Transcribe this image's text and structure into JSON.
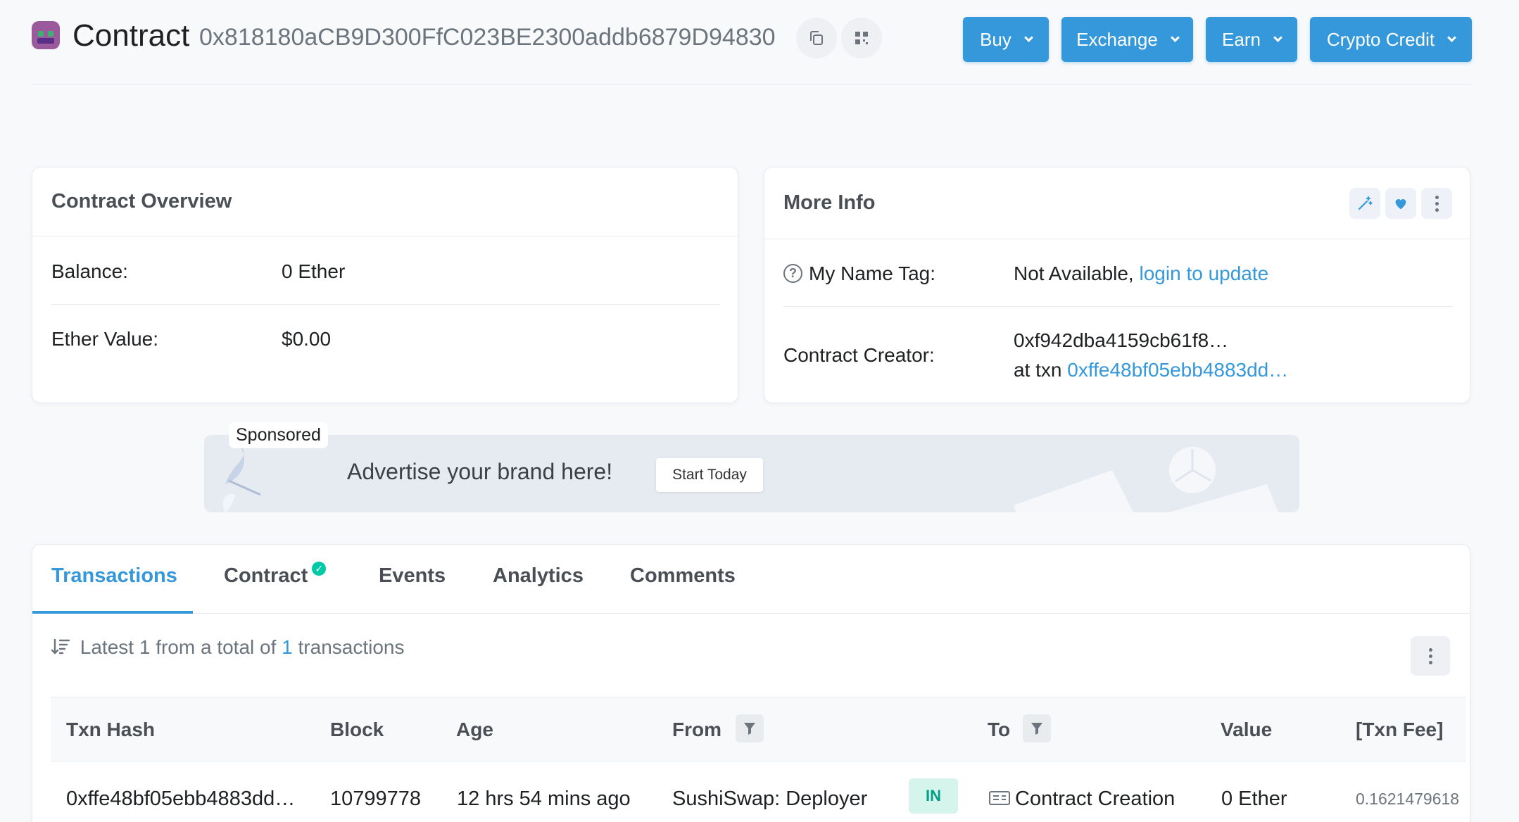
{
  "header": {
    "title": "Contract",
    "address": "0x818180aCB9D300FfC023BE2300addb6879D94830",
    "buttons": [
      "Buy",
      "Exchange",
      "Earn",
      "Crypto Credit"
    ]
  },
  "overview": {
    "title": "Contract Overview",
    "balance_label": "Balance:",
    "balance_value": "0 Ether",
    "ether_value_label": "Ether Value:",
    "ether_value": "$0.00"
  },
  "more_info": {
    "title": "More Info",
    "name_tag_label": "My Name Tag:",
    "name_tag_value": "Not Available,",
    "name_tag_link": "login to update",
    "creator_label": "Contract Creator:",
    "creator_address": "0xf942dba4159cb61f8…",
    "creator_txn_prefix": "at txn",
    "creator_txn": "0xffe48bf05ebb4883dd…"
  },
  "ad": {
    "badge": "Sponsored",
    "text": "Advertise your brand here!",
    "cta": "Start Today"
  },
  "tabs": [
    "Transactions",
    "Contract",
    "Events",
    "Analytics",
    "Comments"
  ],
  "summary": {
    "prefix": "Latest 1 from a total of",
    "count": "1",
    "suffix": "transactions"
  },
  "table": {
    "headers": [
      "Txn Hash",
      "Block",
      "Age",
      "From",
      "To",
      "Value",
      "[Txn Fee]"
    ],
    "rows": [
      {
        "txn_hash": "0xffe48bf05ebb4883dd…",
        "block": "10799778",
        "age": "12 hrs 54 mins ago",
        "from": "SushiSwap: Deployer",
        "direction": "IN",
        "to": "Contract Creation",
        "value": "0 Ether",
        "fee": "0.1621479618"
      }
    ]
  },
  "colors": {
    "accent": "#3498db",
    "in_badge_bg": "#d4f4ec",
    "in_badge_text": "#00a186",
    "verified": "#00c9a7"
  }
}
